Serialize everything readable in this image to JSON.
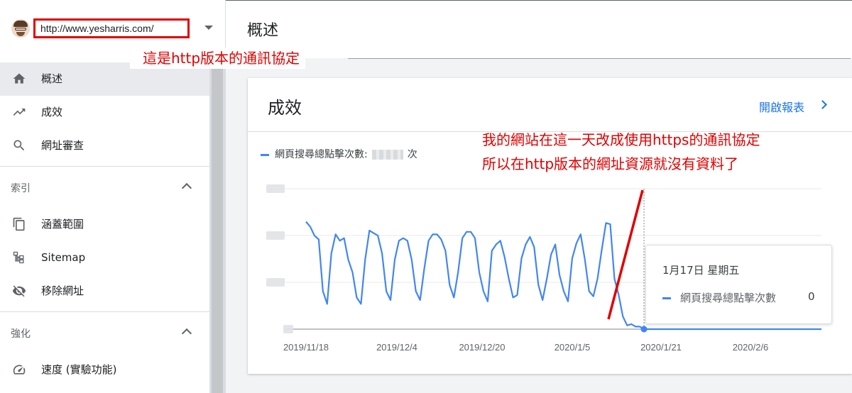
{
  "property": {
    "url": "http://www.yesharris.com/",
    "annotation": "這是http版本的通訊協定"
  },
  "header": {
    "title": "概述"
  },
  "sidebar": {
    "items": [
      {
        "label": "概述",
        "icon": "home-icon",
        "active": true
      },
      {
        "label": "成效",
        "icon": "trending-up-icon"
      },
      {
        "label": "網址審查",
        "icon": "search-icon"
      }
    ],
    "index_section": {
      "label": "索引",
      "items": [
        {
          "label": "涵蓋範圍",
          "icon": "copy-icon"
        },
        {
          "label": "Sitemap",
          "icon": "sitemap-icon"
        },
        {
          "label": "移除網址",
          "icon": "eye-off-icon"
        }
      ]
    },
    "enhance_section": {
      "label": "強化",
      "items": [
        {
          "label": "速度 (實驗功能)",
          "icon": "speed-icon"
        }
      ]
    }
  },
  "card": {
    "title": "成效",
    "open_report": "開啟報表",
    "legend_label": "網頁搜尋總點擊次數:",
    "legend_suffix": "次",
    "annotation_line1": "我的網站在這一天改成使用https的通訊協定",
    "annotation_line2": "所以在http版本的網址資源就沒有資料了",
    "tooltip": {
      "date": "1月17日 星期五",
      "series": "網頁搜尋總點擊次數",
      "value": "0"
    }
  },
  "colors": {
    "accent": "#4285f4",
    "annotation": "#e00000",
    "link": "#1a73e8"
  },
  "chart_data": {
    "type": "line",
    "x_tick_labels": [
      "2019/11/18",
      "2019/12/4",
      "2019/12/20",
      "2020/1/5",
      "2020/1/21",
      "2020/2/6"
    ],
    "y_tick_labels_blurred": true,
    "grid": true,
    "series": [
      {
        "name": "網頁搜尋總點擊次數",
        "values": [
          0.85,
          0.81,
          0.74,
          0.71,
          0.3,
          0.2,
          0.6,
          0.75,
          0.7,
          0.72,
          0.55,
          0.45,
          0.25,
          0.2,
          0.55,
          0.78,
          0.76,
          0.74,
          0.6,
          0.3,
          0.23,
          0.55,
          0.7,
          0.72,
          0.7,
          0.55,
          0.3,
          0.23,
          0.48,
          0.7,
          0.75,
          0.75,
          0.71,
          0.62,
          0.35,
          0.25,
          0.45,
          0.72,
          0.77,
          0.77,
          0.72,
          0.45,
          0.3,
          0.22,
          0.62,
          0.67,
          0.7,
          0.57,
          0.4,
          0.25,
          0.27,
          0.56,
          0.67,
          0.73,
          0.65,
          0.35,
          0.23,
          0.4,
          0.59,
          0.67,
          0.43,
          0.3,
          0.22,
          0.56,
          0.68,
          0.75,
          0.55,
          0.3,
          0.26,
          0.4,
          0.63,
          0.84,
          0.83,
          0.4,
          0.27,
          0.1,
          0.03,
          0.04,
          0.02,
          0.02,
          0.0,
          0.0,
          0.0,
          0.0,
          0.0,
          0.0,
          0.0,
          0.0,
          0.0,
          0.0,
          0.0,
          0.0,
          0.0,
          0.0,
          0.0,
          0.0,
          0.0,
          0.0,
          0.0,
          0.0,
          0.0,
          0.0,
          0.0,
          0.0,
          0.0,
          0.0,
          0.0,
          0.0,
          0.0,
          0.0,
          0.0,
          0.0,
          0.0,
          0.0,
          0.0,
          0.0,
          0.0,
          0.0,
          0.0,
          0.0,
          0.0,
          0.0,
          0.0
        ],
        "highlight": {
          "label": "1月17日 星期五",
          "value": 0
        }
      }
    ]
  }
}
